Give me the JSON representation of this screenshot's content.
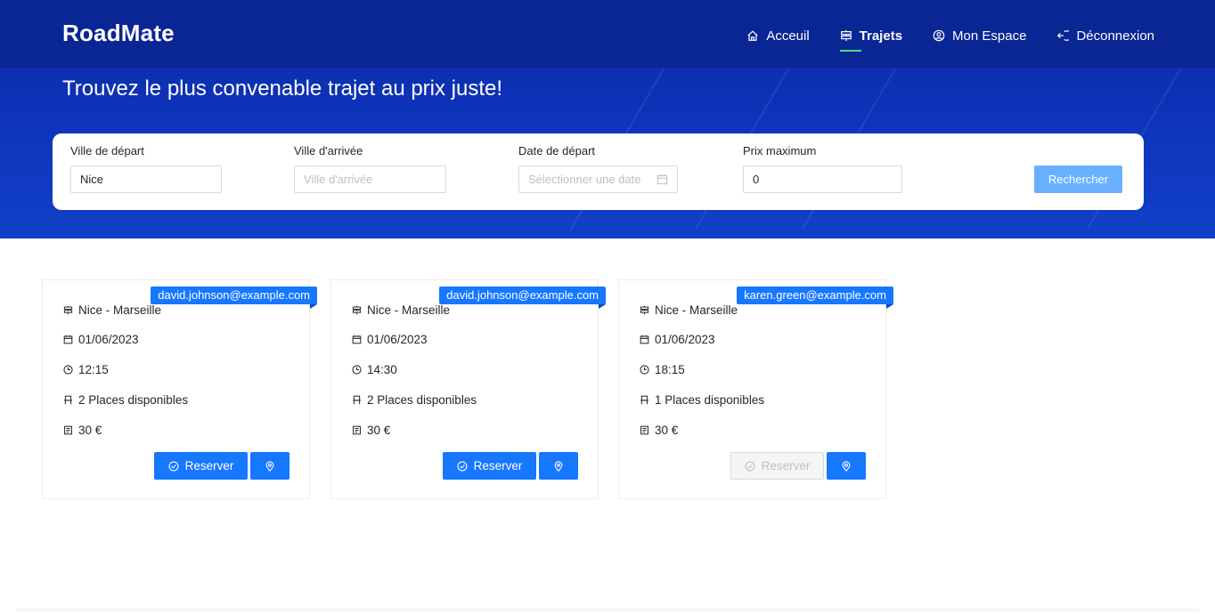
{
  "brand": "RoadMate",
  "nav": [
    {
      "label": "Acceuil",
      "icon": "home-icon",
      "active": false
    },
    {
      "label": "Trajets",
      "icon": "signpost-icon",
      "active": true
    },
    {
      "label": "Mon Espace",
      "icon": "user-circle-icon",
      "active": false
    },
    {
      "label": "Déconnexion",
      "icon": "logout-icon",
      "active": false
    }
  ],
  "tagline": "Trouvez le plus convenable trajet au prix juste!",
  "search": {
    "departure_label": "Ville de départ",
    "departure_value": "Nice",
    "arrival_label": "Ville d'arrivée",
    "arrival_placeholder": "Ville d'arrivée",
    "date_label": "Date de départ",
    "date_placeholder": "Sélectionner une date",
    "price_label": "Prix maximum",
    "price_value": "0",
    "button_label": "Rechercher"
  },
  "trips": [
    {
      "driver": "david.johnson@example.com",
      "route": "Nice - Marseille",
      "date": "01/06/2023",
      "time": "12:15",
      "seats": "2 Places disponibles",
      "price": "30 €",
      "reserve_label": "Reserver",
      "reserve_enabled": true
    },
    {
      "driver": "david.johnson@example.com",
      "route": "Nice - Marseille",
      "date": "01/06/2023",
      "time": "14:30",
      "seats": "2 Places disponibles",
      "price": "30 €",
      "reserve_label": "Reserver",
      "reserve_enabled": true
    },
    {
      "driver": "karen.green@example.com",
      "route": "Nice - Marseille",
      "date": "01/06/2023",
      "time": "18:15",
      "seats": "1 Places disponibles",
      "price": "30 €",
      "reserve_label": "Reserver",
      "reserve_enabled": false
    }
  ],
  "colors": {
    "header_bg": "#0a2594",
    "hero_bg": "#0d33b8",
    "primary": "#1677ff",
    "primary_light": "#69b1ff",
    "active_underline": "#4ade80"
  }
}
